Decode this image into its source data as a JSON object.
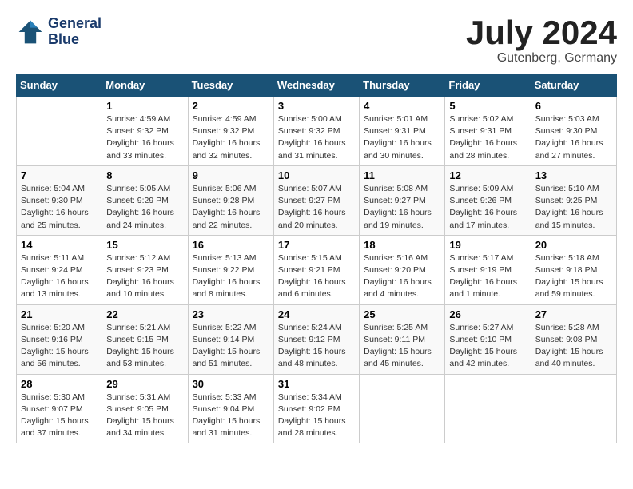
{
  "logo": {
    "line1": "General",
    "line2": "Blue"
  },
  "title": "July 2024",
  "location": "Gutenberg, Germany",
  "header": {
    "days": [
      "Sunday",
      "Monday",
      "Tuesday",
      "Wednesday",
      "Thursday",
      "Friday",
      "Saturday"
    ]
  },
  "weeks": [
    [
      {
        "day": "",
        "sunrise": "",
        "sunset": "",
        "daylight": ""
      },
      {
        "day": "1",
        "sunrise": "Sunrise: 4:59 AM",
        "sunset": "Sunset: 9:32 PM",
        "daylight": "Daylight: 16 hours and 33 minutes."
      },
      {
        "day": "2",
        "sunrise": "Sunrise: 4:59 AM",
        "sunset": "Sunset: 9:32 PM",
        "daylight": "Daylight: 16 hours and 32 minutes."
      },
      {
        "day": "3",
        "sunrise": "Sunrise: 5:00 AM",
        "sunset": "Sunset: 9:32 PM",
        "daylight": "Daylight: 16 hours and 31 minutes."
      },
      {
        "day": "4",
        "sunrise": "Sunrise: 5:01 AM",
        "sunset": "Sunset: 9:31 PM",
        "daylight": "Daylight: 16 hours and 30 minutes."
      },
      {
        "day": "5",
        "sunrise": "Sunrise: 5:02 AM",
        "sunset": "Sunset: 9:31 PM",
        "daylight": "Daylight: 16 hours and 28 minutes."
      },
      {
        "day": "6",
        "sunrise": "Sunrise: 5:03 AM",
        "sunset": "Sunset: 9:30 PM",
        "daylight": "Daylight: 16 hours and 27 minutes."
      }
    ],
    [
      {
        "day": "7",
        "sunrise": "Sunrise: 5:04 AM",
        "sunset": "Sunset: 9:30 PM",
        "daylight": "Daylight: 16 hours and 25 minutes."
      },
      {
        "day": "8",
        "sunrise": "Sunrise: 5:05 AM",
        "sunset": "Sunset: 9:29 PM",
        "daylight": "Daylight: 16 hours and 24 minutes."
      },
      {
        "day": "9",
        "sunrise": "Sunrise: 5:06 AM",
        "sunset": "Sunset: 9:28 PM",
        "daylight": "Daylight: 16 hours and 22 minutes."
      },
      {
        "day": "10",
        "sunrise": "Sunrise: 5:07 AM",
        "sunset": "Sunset: 9:27 PM",
        "daylight": "Daylight: 16 hours and 20 minutes."
      },
      {
        "day": "11",
        "sunrise": "Sunrise: 5:08 AM",
        "sunset": "Sunset: 9:27 PM",
        "daylight": "Daylight: 16 hours and 19 minutes."
      },
      {
        "day": "12",
        "sunrise": "Sunrise: 5:09 AM",
        "sunset": "Sunset: 9:26 PM",
        "daylight": "Daylight: 16 hours and 17 minutes."
      },
      {
        "day": "13",
        "sunrise": "Sunrise: 5:10 AM",
        "sunset": "Sunset: 9:25 PM",
        "daylight": "Daylight: 16 hours and 15 minutes."
      }
    ],
    [
      {
        "day": "14",
        "sunrise": "Sunrise: 5:11 AM",
        "sunset": "Sunset: 9:24 PM",
        "daylight": "Daylight: 16 hours and 13 minutes."
      },
      {
        "day": "15",
        "sunrise": "Sunrise: 5:12 AM",
        "sunset": "Sunset: 9:23 PM",
        "daylight": "Daylight: 16 hours and 10 minutes."
      },
      {
        "day": "16",
        "sunrise": "Sunrise: 5:13 AM",
        "sunset": "Sunset: 9:22 PM",
        "daylight": "Daylight: 16 hours and 8 minutes."
      },
      {
        "day": "17",
        "sunrise": "Sunrise: 5:15 AM",
        "sunset": "Sunset: 9:21 PM",
        "daylight": "Daylight: 16 hours and 6 minutes."
      },
      {
        "day": "18",
        "sunrise": "Sunrise: 5:16 AM",
        "sunset": "Sunset: 9:20 PM",
        "daylight": "Daylight: 16 hours and 4 minutes."
      },
      {
        "day": "19",
        "sunrise": "Sunrise: 5:17 AM",
        "sunset": "Sunset: 9:19 PM",
        "daylight": "Daylight: 16 hours and 1 minute."
      },
      {
        "day": "20",
        "sunrise": "Sunrise: 5:18 AM",
        "sunset": "Sunset: 9:18 PM",
        "daylight": "Daylight: 15 hours and 59 minutes."
      }
    ],
    [
      {
        "day": "21",
        "sunrise": "Sunrise: 5:20 AM",
        "sunset": "Sunset: 9:16 PM",
        "daylight": "Daylight: 15 hours and 56 minutes."
      },
      {
        "day": "22",
        "sunrise": "Sunrise: 5:21 AM",
        "sunset": "Sunset: 9:15 PM",
        "daylight": "Daylight: 15 hours and 53 minutes."
      },
      {
        "day": "23",
        "sunrise": "Sunrise: 5:22 AM",
        "sunset": "Sunset: 9:14 PM",
        "daylight": "Daylight: 15 hours and 51 minutes."
      },
      {
        "day": "24",
        "sunrise": "Sunrise: 5:24 AM",
        "sunset": "Sunset: 9:12 PM",
        "daylight": "Daylight: 15 hours and 48 minutes."
      },
      {
        "day": "25",
        "sunrise": "Sunrise: 5:25 AM",
        "sunset": "Sunset: 9:11 PM",
        "daylight": "Daylight: 15 hours and 45 minutes."
      },
      {
        "day": "26",
        "sunrise": "Sunrise: 5:27 AM",
        "sunset": "Sunset: 9:10 PM",
        "daylight": "Daylight: 15 hours and 42 minutes."
      },
      {
        "day": "27",
        "sunrise": "Sunrise: 5:28 AM",
        "sunset": "Sunset: 9:08 PM",
        "daylight": "Daylight: 15 hours and 40 minutes."
      }
    ],
    [
      {
        "day": "28",
        "sunrise": "Sunrise: 5:30 AM",
        "sunset": "Sunset: 9:07 PM",
        "daylight": "Daylight: 15 hours and 37 minutes."
      },
      {
        "day": "29",
        "sunrise": "Sunrise: 5:31 AM",
        "sunset": "Sunset: 9:05 PM",
        "daylight": "Daylight: 15 hours and 34 minutes."
      },
      {
        "day": "30",
        "sunrise": "Sunrise: 5:33 AM",
        "sunset": "Sunset: 9:04 PM",
        "daylight": "Daylight: 15 hours and 31 minutes."
      },
      {
        "day": "31",
        "sunrise": "Sunrise: 5:34 AM",
        "sunset": "Sunset: 9:02 PM",
        "daylight": "Daylight: 15 hours and 28 minutes."
      },
      {
        "day": "",
        "sunrise": "",
        "sunset": "",
        "daylight": ""
      },
      {
        "day": "",
        "sunrise": "",
        "sunset": "",
        "daylight": ""
      },
      {
        "day": "",
        "sunrise": "",
        "sunset": "",
        "daylight": ""
      }
    ]
  ]
}
